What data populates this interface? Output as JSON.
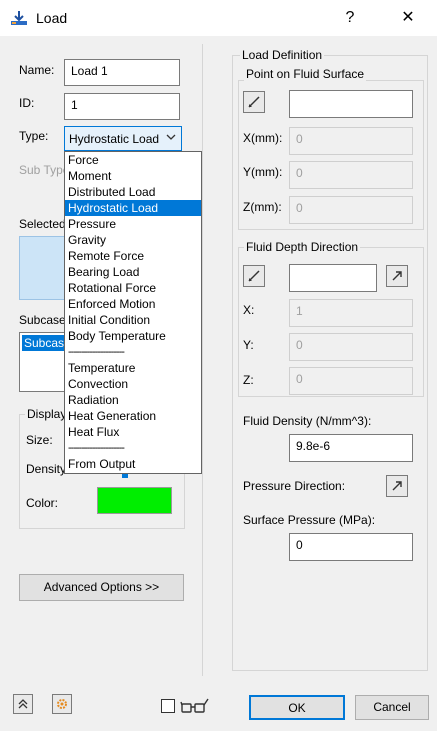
{
  "window": {
    "title": "Load",
    "help_glyph": "?",
    "close_glyph": "✕"
  },
  "left": {
    "name_label": "Name:",
    "name_value": "Load 1",
    "id_label": "ID:",
    "id_value": "1",
    "type_label": "Type:",
    "type_value": "Hydrostatic Load",
    "subtype_label": "Sub Type",
    "selected_label": "Selected",
    "subcase_label": "Subcase",
    "subcase_item": "Subcase",
    "display_title": "Display",
    "size_label": "Size:",
    "density_label": "Density",
    "color_label": "Color:",
    "color_value": "#00ee00",
    "advanced_button": "Advanced Options >>"
  },
  "dropdown": {
    "items": [
      "Force",
      "Moment",
      "Distributed Load",
      "Hydrostatic Load",
      "Pressure",
      "Gravity",
      "Remote Force",
      "Bearing Load",
      "Rotational Force",
      "Enforced Motion",
      "Initial Condition",
      "Body Temperature",
      "---------------------",
      "Temperature",
      "Convection",
      "Radiation",
      "Heat Generation",
      "Heat Flux",
      "---------------------",
      "From Output"
    ],
    "selected_index": 3
  },
  "right": {
    "load_definition_title": "Load Definition",
    "point_group_title": "Point on Fluid Surface",
    "x_label": "X(mm):",
    "x_value": "0",
    "y_label": "Y(mm):",
    "y_value": "0",
    "z_label": "Z(mm):",
    "z_value": "0",
    "depth_group_title": "Fluid Depth Direction",
    "dx_label": "X:",
    "dx_value": "1",
    "dy_label": "Y:",
    "dy_value": "0",
    "dz_label": "Z:",
    "dz_value": "0",
    "density_label": "Fluid Density (N/mm^3):",
    "density_value": "9.8e-6",
    "pressure_dir_label": "Pressure Direction:",
    "surface_pressure_label": "Surface Pressure (MPa):",
    "surface_pressure_value": "0"
  },
  "footer": {
    "ok": "OK",
    "cancel": "Cancel"
  }
}
